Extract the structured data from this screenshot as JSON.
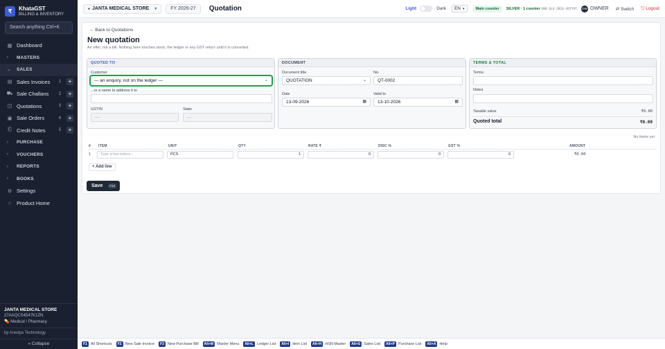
{
  "brand": {
    "logo": "₹",
    "name": "KhataGST",
    "subtitle": "BILLING & INVENTORY"
  },
  "sidebar": {
    "search": "Search anything  Ctrl+K",
    "items": [
      {
        "label": "Dashboard",
        "icon": "dashboard-icon"
      },
      {
        "label": "MASTERS",
        "icon": "chevron-right-icon"
      },
      {
        "label": "SALES",
        "icon": "chevron-down-icon"
      },
      {
        "label": "Sales Invoices",
        "count": "1",
        "icon": "invoice-icon"
      },
      {
        "label": "Sale Challans",
        "count": "2",
        "icon": "challan-icon"
      },
      {
        "label": "Quotations",
        "count": "3",
        "icon": "quotation-icon"
      },
      {
        "label": "Sale Orders",
        "count": "4",
        "icon": "order-icon"
      },
      {
        "label": "Credit Notes",
        "count": "5",
        "icon": "credit-note-icon"
      },
      {
        "label": "PURCHASE",
        "icon": "chevron-right-icon"
      },
      {
        "label": "VOUCHERS",
        "icon": "chevron-right-icon"
      },
      {
        "label": "REPORTS",
        "icon": "chevron-right-icon"
      },
      {
        "label": "BOOKS",
        "icon": "chevron-right-icon"
      },
      {
        "label": "Settings",
        "icon": "gear-icon"
      },
      {
        "label": "Product Home",
        "icon": "home-icon"
      }
    ],
    "store": {
      "name": "JANTA MEDICAL STORE",
      "gstin": "27AAQCS4547K1ZN",
      "type": "Medical / Pharmacy"
    },
    "by": "by Anedya Technology",
    "collapse": "« Collapse"
  },
  "topbar": {
    "store": "JANTA MEDICAL STORE",
    "fy": "FY 2026-27",
    "title": "Quotation",
    "light": "Light",
    "dark": "Dark",
    "lang": "EN",
    "main_counter": "Main counter",
    "license": "SILVER · 1 counter",
    "license_code": "ANO-SLV-2026-4U7Y97",
    "avatar": "OW",
    "owner": "OWNER",
    "switch": "Switch",
    "logout": "Logout"
  },
  "page": {
    "back": "← Back to Quotations",
    "heading": "New quotation",
    "subtitle": "An offer, not a bill. Nothing here touches stock, the ledger or any GST return until it is converted."
  },
  "quoted_to": {
    "header": "QUOTED TO",
    "customer_label": "Customer",
    "customer_value": "— an enquiry, not on the ledger —",
    "name_label": "...or a name to address it to",
    "name_value": "",
    "gstin_label": "GSTIN",
    "gstin_value": "—",
    "state_label": "State",
    "state_value": "—"
  },
  "document": {
    "header": "DOCUMENT",
    "title_label": "Document title",
    "title_value": "QUOTATION",
    "no_label": "No.",
    "no_value": "QT-0002",
    "date_label": "Date",
    "date_value": "13-09-2026",
    "valid_label": "Valid to",
    "valid_value": "13-10-2026"
  },
  "terms": {
    "header": "TERMS & TOTAL",
    "terms_label": "Terms",
    "notes_label": "Notes",
    "taxable_label": "Taxable value",
    "taxable_value": "₹0.00",
    "total_label": "Quoted total",
    "total_value": "₹0.00"
  },
  "items": {
    "no_items": "No items yet",
    "columns": [
      "#",
      "ITEM",
      "UNIT",
      "QTY",
      "RATE ₹",
      "DISC %",
      "GST %",
      "AMOUNT"
    ],
    "row": {
      "num": "1",
      "item_placeholder": "Type a few letters...",
      "unit": "PCS",
      "qty": "1",
      "rate": "0",
      "disc": "0",
      "gst": "0",
      "amount": "₹0.00"
    },
    "add_line": "+ Add line"
  },
  "save": {
    "label": "Save",
    "key": "F10"
  },
  "shortcuts": [
    {
      "key": "F1",
      "label": "All Shortcuts"
    },
    {
      "key": "F2",
      "label": "New Sale Invoice"
    },
    {
      "key": "F3",
      "label": "New Purchase Bill"
    },
    {
      "key": "Alt+M",
      "label": "Master Menu"
    },
    {
      "key": "Alt+L",
      "label": "Ledger List"
    },
    {
      "key": "Alt+I",
      "label": "Item List"
    },
    {
      "key": "Alt+H",
      "label": "HSN Master"
    },
    {
      "key": "Alt+S",
      "label": "Sales List"
    },
    {
      "key": "Alt+P",
      "label": "Purchase List"
    },
    {
      "key": "Alt+A",
      "label": "Help"
    }
  ]
}
